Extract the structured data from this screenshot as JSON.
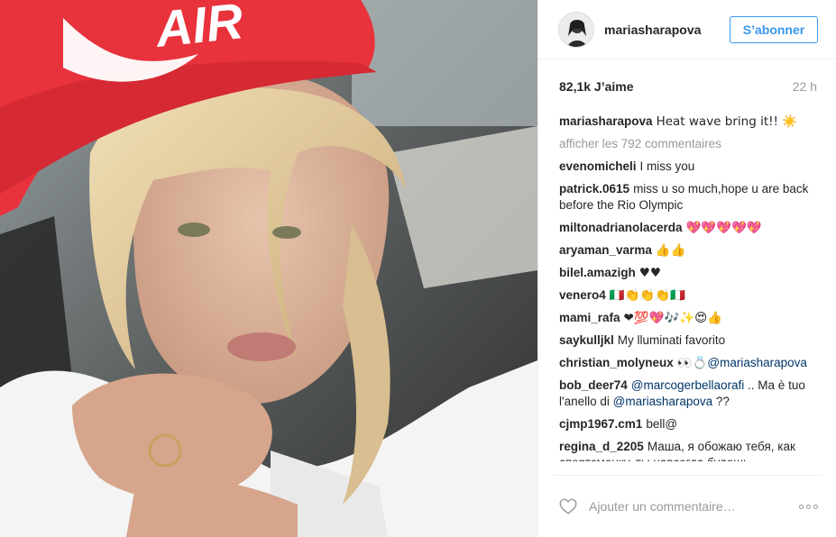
{
  "post": {
    "author": "mariasharapova",
    "follow_label": "S’abonner",
    "likes": "82,1k J’aime",
    "time_ago": "22 h",
    "caption": {
      "user": "mariasharapova",
      "text": "Heat wave bring it!! ☀️"
    },
    "view_all_label": "afficher les 792 commentaires",
    "photo_cap_text": "AIR",
    "comments": [
      {
        "user": "evenomicheli",
        "text": "I miss you"
      },
      {
        "user": "patrick.0615",
        "text": "miss u so much,hope u are back before the Rio Olympic"
      },
      {
        "user": "miltonadrianolacerda",
        "text": "💖💖💖💖💖"
      },
      {
        "user": "aryaman_varma",
        "text": "👍👍"
      },
      {
        "user": "bilel.amazigh",
        "text": "♥♥"
      },
      {
        "user": "venero4",
        "text": "🇮🇹👏👏👏🇮🇹"
      },
      {
        "user": "mami_rafa",
        "text": "❤💯💖🎶✨😍👍"
      },
      {
        "user": "saykulljkl",
        "text": "My lluminati favorito"
      },
      {
        "user": "christian_molyneux",
        "text": "👀💍",
        "mention": "@mariasharapova"
      },
      {
        "user": "bob_deer74",
        "text_before": "",
        "mention": "@marcogerbellaorafi",
        "text_middle": " .. Ma è tuo l'anello di ",
        "mention2": "@mariasharapova",
        "text_after": " ??"
      },
      {
        "user": "cjmp1967.cm1",
        "text": "bell@"
      },
      {
        "user": "regina_d_2205",
        "text": "Маша, я обожаю тебя, как спортсменку, ты навсегда будешь"
      }
    ],
    "add_comment_placeholder": "Ajouter un commentaire…"
  },
  "icons": {
    "heart": "heart-outline-icon",
    "more": "more-options-icon"
  },
  "colors": {
    "accent": "#3897f0",
    "mention": "#003569",
    "muted": "#999999",
    "cap_red": "#e8323c"
  }
}
